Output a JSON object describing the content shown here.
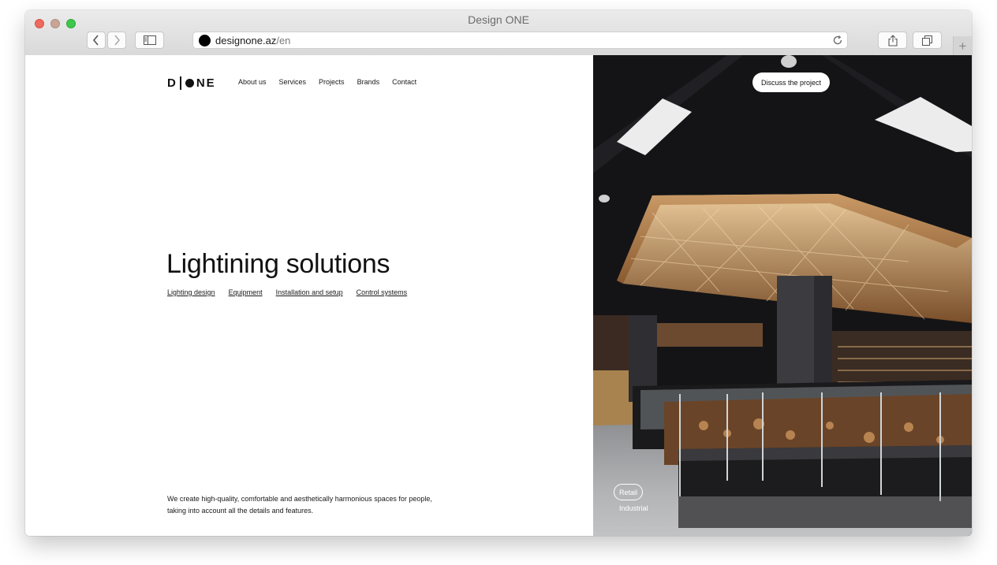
{
  "browser": {
    "window_title": "Design ONE",
    "url_domain": "designone.az",
    "url_path": "/en",
    "new_tab_glyph": "+"
  },
  "site": {
    "logo": {
      "left": "D",
      "right": "NE"
    },
    "nav": [
      "About us",
      "Services",
      "Projects",
      "Brands",
      "Contact"
    ],
    "cta": "Discuss the project"
  },
  "hero": {
    "title": "Lightining solutions",
    "sublinks": [
      "Lighting design",
      "Equipment",
      "Installation and setup",
      "Control systems"
    ],
    "description": "We create high-quality, comfortable and aesthetically harmonious spaces for people, taking into account all the details and features."
  },
  "photo": {
    "active_tag": "Retail",
    "secondary_tag": "Industrial"
  },
  "colors": {
    "photo_background": "#151516",
    "wood": "#b07a4a",
    "text": "#111111"
  }
}
